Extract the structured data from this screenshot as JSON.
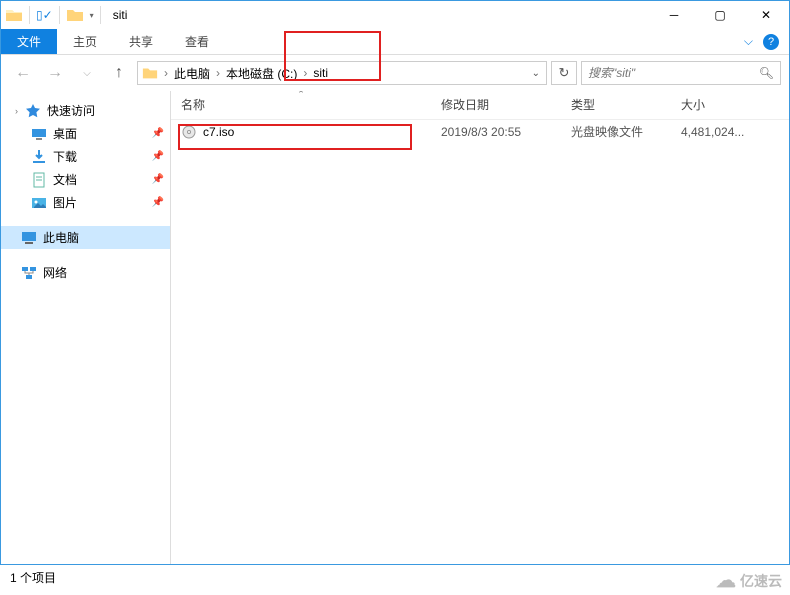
{
  "title": "siti",
  "ribbon": {
    "file": "文件",
    "home": "主页",
    "share": "共享",
    "view": "查看"
  },
  "breadcrumbs": [
    "此电脑",
    "本地磁盘 (C:)",
    "siti"
  ],
  "search_placeholder": "搜索\"siti\"",
  "sidebar": {
    "quick_access": "快速访问",
    "items": [
      {
        "label": "桌面"
      },
      {
        "label": "下载"
      },
      {
        "label": "文档"
      },
      {
        "label": "图片"
      }
    ],
    "this_pc": "此电脑",
    "network": "网络"
  },
  "columns": {
    "name": "名称",
    "date": "修改日期",
    "type": "类型",
    "size": "大小"
  },
  "files": [
    {
      "name": "c7.iso",
      "date": "2019/8/3 20:55",
      "type": "光盘映像文件",
      "size": "4,481,024..."
    }
  ],
  "status": "1 个项目",
  "watermark": "亿速云"
}
